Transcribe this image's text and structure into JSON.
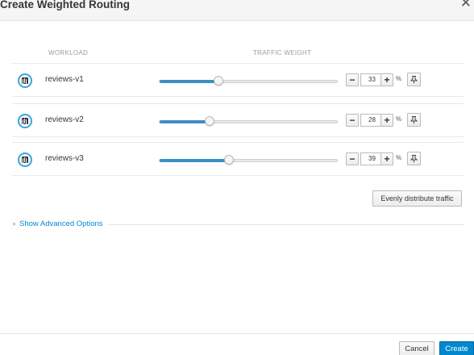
{
  "dialog": {
    "title": "Create Weighted Routing",
    "close_icon": "✕"
  },
  "columns": {
    "workload": "WORKLOAD",
    "traffic_weight": "TRAFFIC WEIGHT"
  },
  "workloads": [
    {
      "name": "reviews-v1",
      "weight": "33",
      "fraction": 0.33
    },
    {
      "name": "reviews-v2",
      "weight": "28",
      "fraction": 0.28
    },
    {
      "name": "reviews-v3",
      "weight": "39",
      "fraction": 0.39
    }
  ],
  "controls": {
    "minus": "−",
    "plus": "+",
    "percent": "%"
  },
  "evenly_distribute_label": "Evenly distribute traffic",
  "advanced": {
    "caret": "›",
    "label": "Show Advanced Options"
  },
  "footer": {
    "cancel_label": "Cancel",
    "create_label": "Create"
  },
  "colors": {
    "accent": "#0088ce",
    "slider_fill": "#3c8fc4",
    "workload_icon_ring": "#39a5dc"
  }
}
